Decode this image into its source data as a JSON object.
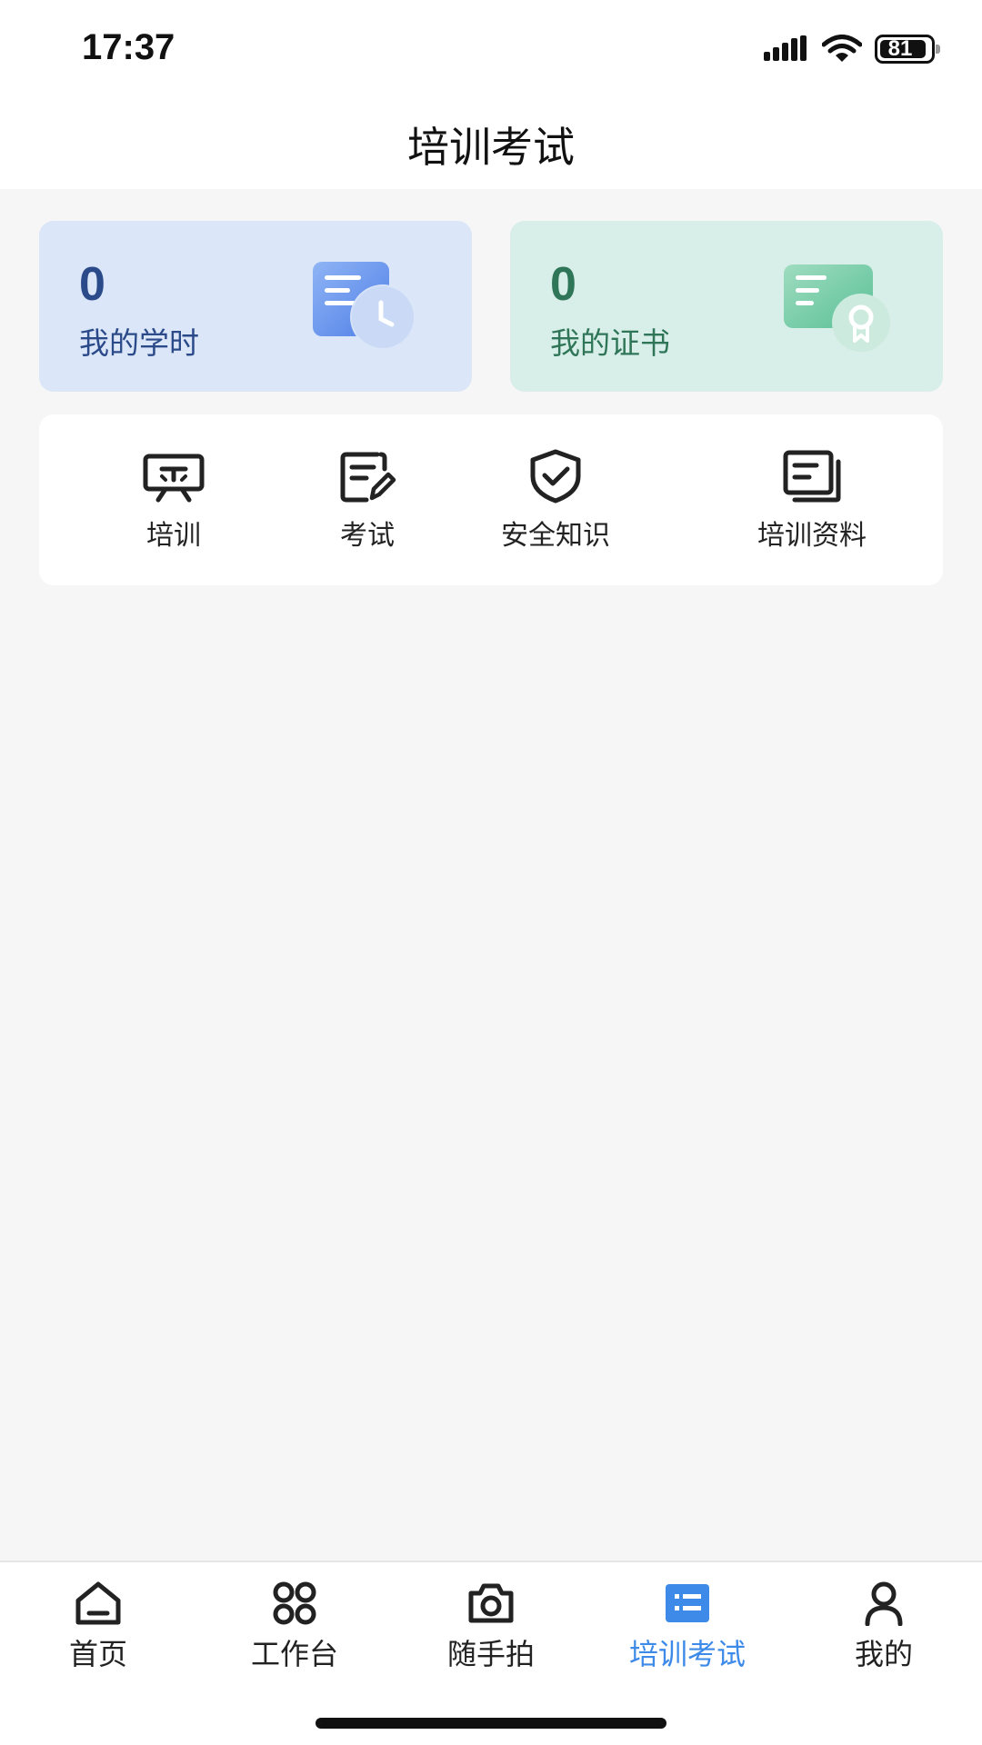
{
  "status_bar": {
    "time": "17:37",
    "battery": "81"
  },
  "header": {
    "title": "培训考试"
  },
  "stats": {
    "hours": {
      "value": "0",
      "label": "我的学时",
      "icon": "document-clock-icon"
    },
    "certificates": {
      "value": "0",
      "label": "我的证书",
      "icon": "certificate-icon"
    }
  },
  "quick_menu": [
    {
      "label": "培训",
      "icon": "training-board-icon"
    },
    {
      "label": "考试",
      "icon": "exam-edit-icon"
    },
    {
      "label": "安全知识",
      "icon": "shield-check-icon"
    },
    {
      "label": "培训资料",
      "icon": "documents-icon"
    }
  ],
  "tab_bar": [
    {
      "label": "首页",
      "icon": "home-icon"
    },
    {
      "label": "工作台",
      "icon": "grid-icon"
    },
    {
      "label": "随手拍",
      "icon": "camera-icon"
    },
    {
      "label": "培训考试",
      "icon": "list-icon",
      "active": true
    },
    {
      "label": "我的",
      "icon": "user-icon"
    }
  ],
  "colors": {
    "accent": "#3d8ae8",
    "hours_card": "#dbe6f8",
    "cert_card": "#d8eee9",
    "background": "#f6f6f6"
  }
}
